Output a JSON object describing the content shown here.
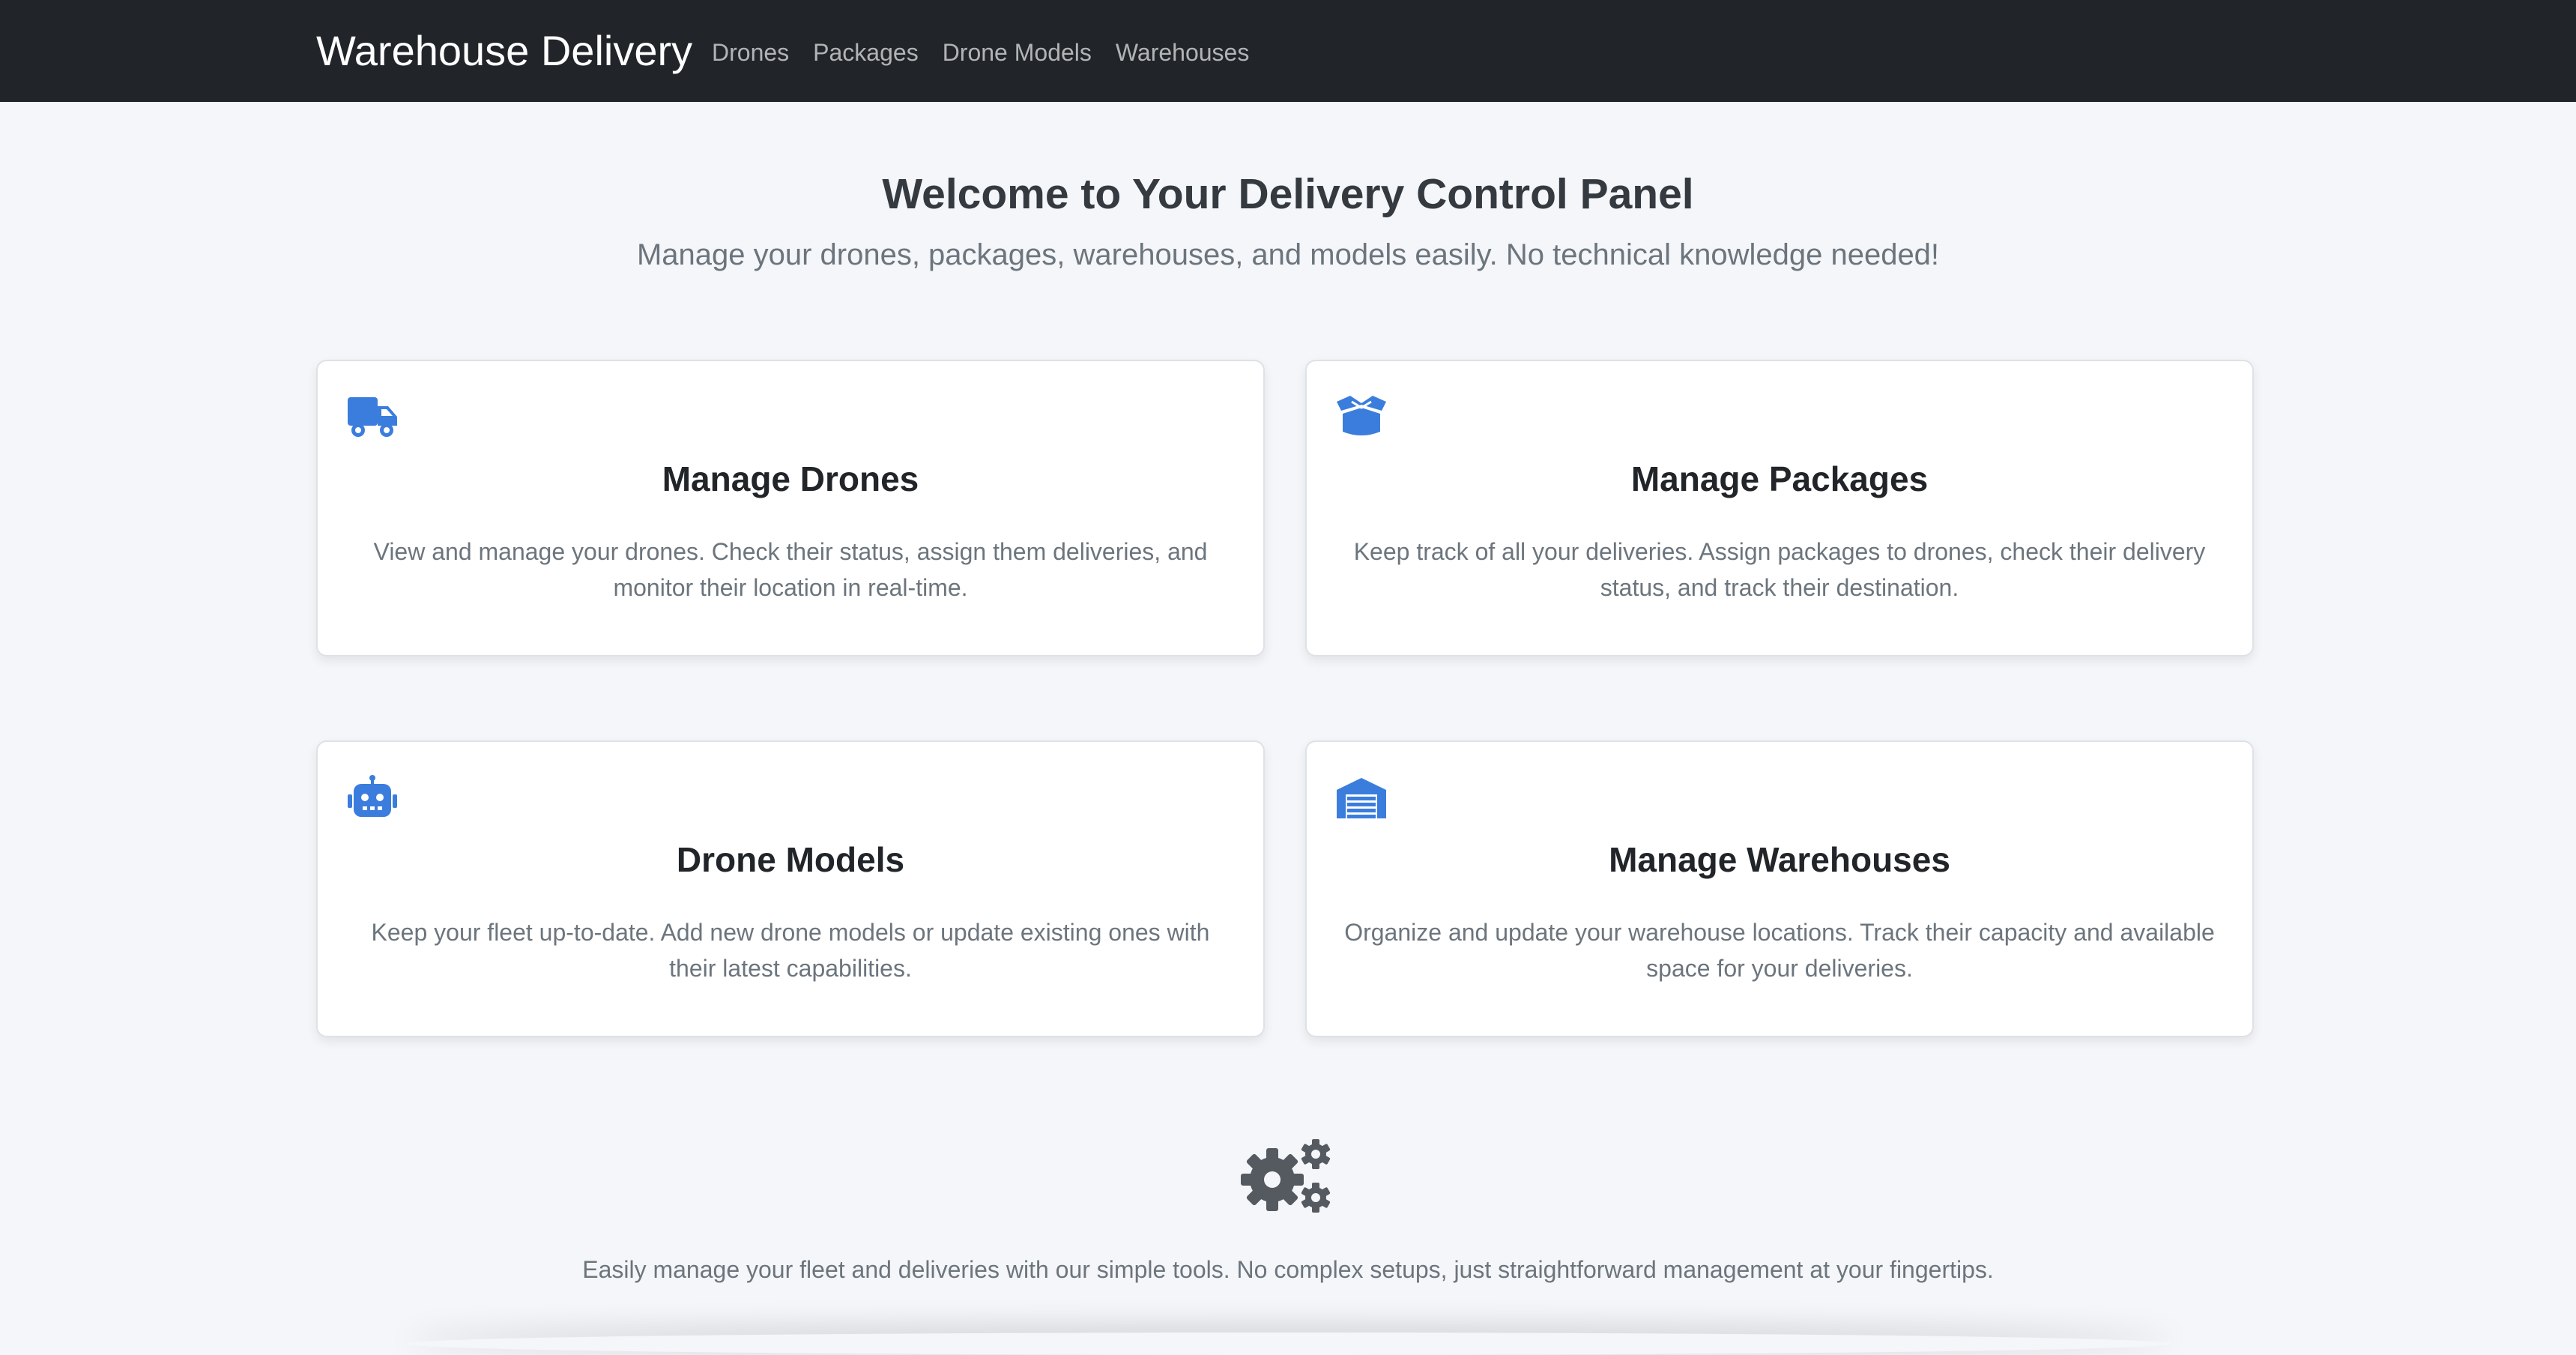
{
  "navbar": {
    "brand": "Warehouse Delivery",
    "links": [
      {
        "label": "Drones"
      },
      {
        "label": "Packages"
      },
      {
        "label": "Drone Models"
      },
      {
        "label": "Warehouses"
      }
    ]
  },
  "hero": {
    "title": "Welcome to Your Delivery Control Panel",
    "subtitle": "Manage your drones, packages, warehouses, and models easily. No technical knowledge needed!"
  },
  "cards": [
    {
      "icon": "truck-icon",
      "title": "Manage Drones",
      "text": "View and manage your drones. Check their status, assign them deliveries, and monitor their location in real-time."
    },
    {
      "icon": "open-box-icon",
      "title": "Manage Packages",
      "text": "Keep track of all your deliveries. Assign packages to drones, check their delivery status, and track their destination."
    },
    {
      "icon": "robot-icon",
      "title": "Drone Models",
      "text": "Keep your fleet up-to-date. Add new drone models or update existing ones with their latest capabilities."
    },
    {
      "icon": "warehouse-icon",
      "title": "Manage Warehouses",
      "text": "Organize and update your warehouse locations. Track their capacity and available space for your deliveries."
    }
  ],
  "footer": {
    "icon": "gears-icon",
    "text": "Easily manage your fleet and deliveries with our simple tools. No complex setups, just straightforward management at your fingertips."
  },
  "colors": {
    "navbar_bg": "#212529",
    "page_bg": "#f4f6f9",
    "accent": "#3b7ddd",
    "gear": "#555a60"
  }
}
